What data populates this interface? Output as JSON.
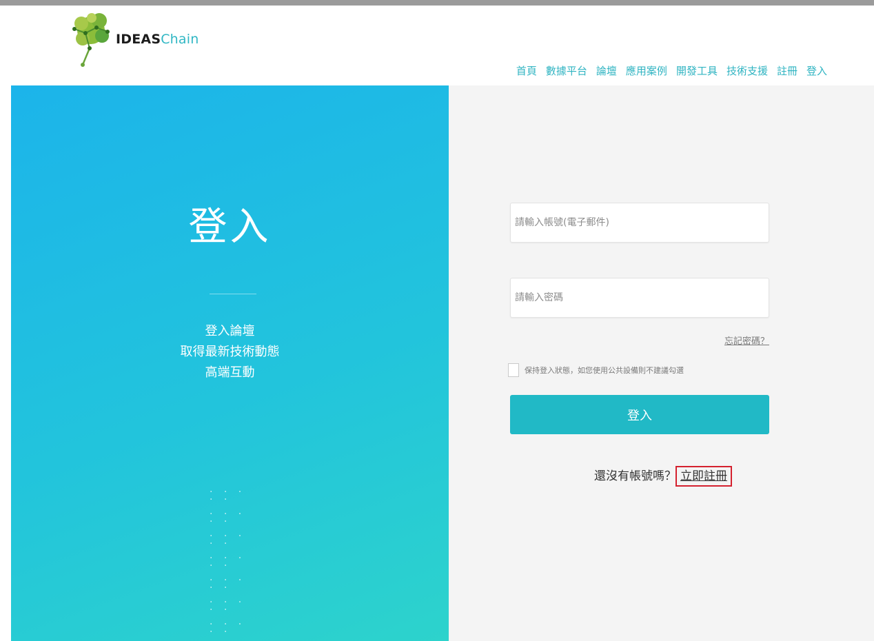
{
  "header": {
    "brand_bold": "IDEAS",
    "brand_light": "Chain",
    "nav": [
      "首頁",
      "數據平台",
      "論壇",
      "應用案例",
      "開發工具",
      "技術支援",
      "註冊",
      "登入"
    ]
  },
  "hero": {
    "title": "登入",
    "lines": [
      "登入論壇",
      "取得最新技術動態",
      "高端互動"
    ]
  },
  "form": {
    "account_placeholder": "請輸入帳號(電子郵件)",
    "password_placeholder": "請輸入密碼",
    "forgot_label": "忘記密碼？",
    "remember_label": "保持登入狀態，如您使用公共設備則不建議勾選",
    "login_button": "登入",
    "no_account_text": "還沒有帳號嗎？",
    "signup_link": "立即註冊"
  },
  "colors": {
    "accent": "#21b9c6",
    "hero_gradient_start": "#1cb4ea",
    "hero_gradient_end": "#2dd3cc",
    "highlight_box": "#d4202e"
  },
  "icons": {
    "logo": "brain-network-logo-icon"
  }
}
